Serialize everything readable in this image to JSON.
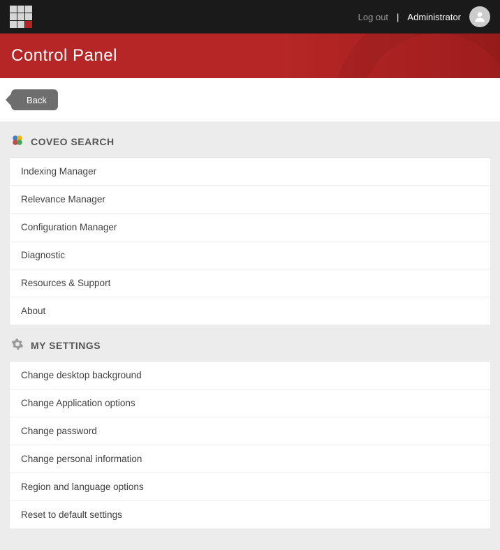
{
  "topbar": {
    "logout": "Log out",
    "user": "Administrator"
  },
  "page": {
    "title": "Control Panel",
    "back": "Back"
  },
  "sections": {
    "coveo": {
      "title": "COVEO SEARCH",
      "items": [
        "Indexing Manager",
        "Relevance Manager",
        "Configuration Manager",
        "Diagnostic",
        "Resources & Support",
        "About"
      ]
    },
    "settings": {
      "title": "MY SETTINGS",
      "items": [
        "Change desktop background",
        "Change Application options",
        "Change password",
        "Change personal information",
        "Region and language options",
        "Reset to default settings"
      ]
    }
  }
}
